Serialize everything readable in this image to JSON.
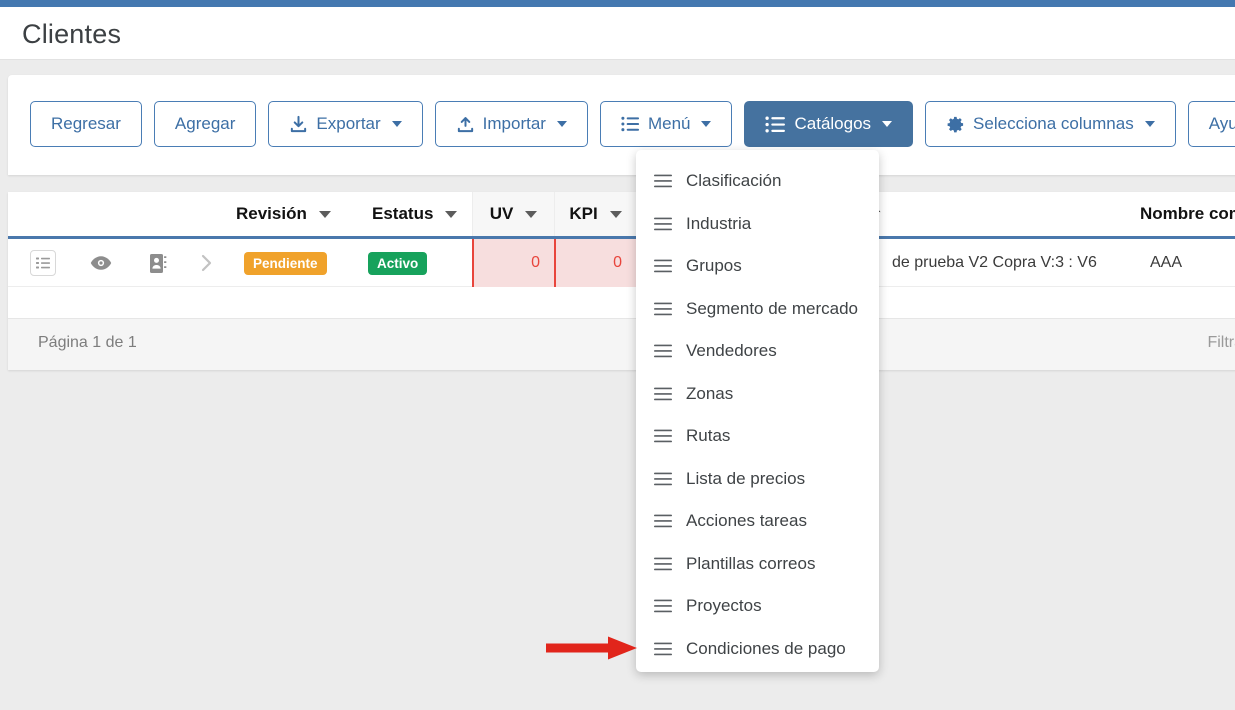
{
  "theme": {
    "accent": "#4478b0",
    "primary_button_bg": "#45729f",
    "badge_warn": "#f0a22b",
    "badge_ok": "#17a25c",
    "danger": "#e8453c",
    "danger_cell_bg": "#f7dede",
    "page_bg": "#ececec",
    "annotation": "#e1251b"
  },
  "header": {
    "title": "Clientes"
  },
  "toolbar": {
    "buttons": [
      {
        "label": "Regresar",
        "icon": "none",
        "caret": false,
        "primary": false
      },
      {
        "label": "Agregar",
        "icon": "none",
        "caret": false,
        "primary": false
      },
      {
        "label": "Exportar",
        "icon": "download-icon",
        "caret": true,
        "primary": false
      },
      {
        "label": "Importar",
        "icon": "upload-icon",
        "caret": true,
        "primary": false
      },
      {
        "label": "Menú",
        "icon": "list-icon",
        "caret": true,
        "primary": false
      },
      {
        "label": "Catálogos",
        "icon": "list-icon",
        "caret": true,
        "primary": true
      },
      {
        "label": "Selecciona columnas",
        "icon": "gear-icon",
        "caret": true,
        "primary": false
      },
      {
        "label": "Ayuda",
        "icon": "none",
        "caret": false,
        "primary": false
      }
    ]
  },
  "catalogos_menu": {
    "open": true,
    "items": [
      {
        "label": "Clasificación",
        "icon": "list-icon"
      },
      {
        "label": "Industria",
        "icon": "list-icon"
      },
      {
        "label": "Grupos",
        "icon": "list-icon"
      },
      {
        "label": "Segmento de mercado",
        "icon": "list-icon"
      },
      {
        "label": "Vendedores",
        "icon": "list-icon"
      },
      {
        "label": "Zonas",
        "icon": "list-icon"
      },
      {
        "label": "Rutas",
        "icon": "list-icon"
      },
      {
        "label": "Lista de precios",
        "icon": "list-icon"
      },
      {
        "label": "Acciones tareas",
        "icon": "list-icon"
      },
      {
        "label": "Plantillas correos",
        "icon": "list-icon"
      },
      {
        "label": "Proyectos",
        "icon": "list-icon"
      },
      {
        "label": "Condiciones de pago",
        "icon": "list-icon"
      }
    ]
  },
  "grid": {
    "columns": [
      {
        "label": "Revisión",
        "sort": "caret"
      },
      {
        "label": "Estatus",
        "sort": "caret"
      },
      {
        "label": "UV",
        "sort": "caret"
      },
      {
        "label": "KPI",
        "sort": "caret"
      },
      {
        "label": "",
        "sort": "asc"
      },
      {
        "label": "Nombre com",
        "sort": "none"
      }
    ],
    "row": {
      "actions": [
        "list-box-icon",
        "eye-icon",
        "contact-card-icon",
        "chevron-right-icon"
      ],
      "revision": "Pendiente",
      "estatus": "Activo",
      "uv": "0",
      "kpi": "0",
      "descripcion": "de prueba V2 Copra V:3 : V6",
      "nombre_comercial": "AAA"
    }
  },
  "footer": {
    "page_info": "Página 1 de 1",
    "filter_label": "Filtra"
  },
  "annotation": {
    "type": "arrow",
    "points_to": "Condiciones de pago"
  }
}
